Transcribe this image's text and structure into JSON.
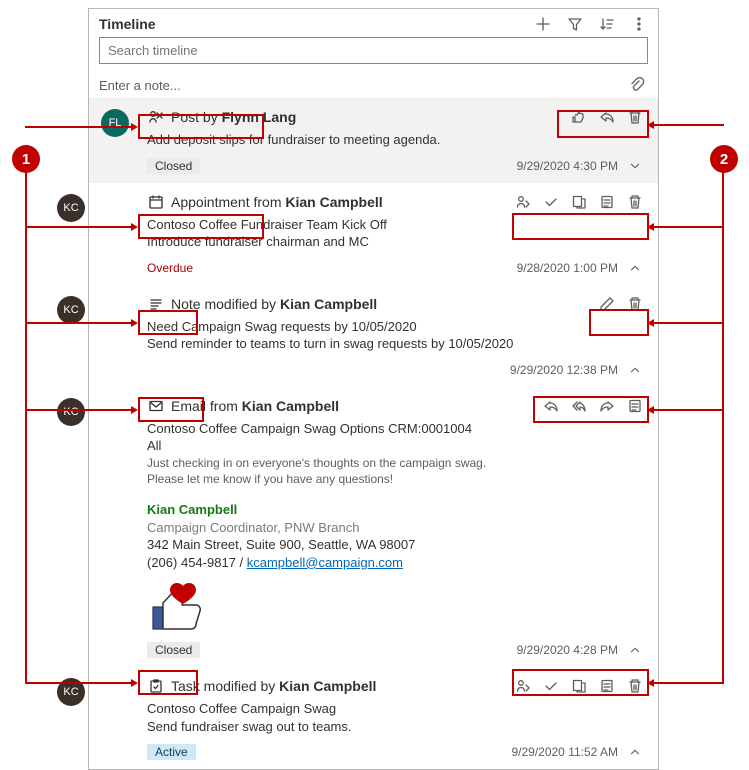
{
  "header": {
    "title": "Timeline",
    "search_placeholder": "Search timeline",
    "note_placeholder": "Enter a note..."
  },
  "callouts": {
    "left": "1",
    "right": "2"
  },
  "items": [
    {
      "avatar": "FL",
      "avatar_class": "av-teal",
      "type": "Post",
      "by_prefix": " by ",
      "author": "Flynn Lang",
      "lines": [
        "Add deposit slips for fundraiser to meeting agenda."
      ],
      "badge": "Closed",
      "badge_class": "",
      "timestamp": "9/29/2020 4:30 PM",
      "chevron": "down",
      "shaded": true,
      "actions": [
        "like",
        "reply",
        "delete"
      ],
      "type_icon": "post"
    },
    {
      "avatar": "KC",
      "avatar_class": "av-brown",
      "type": "Appointment",
      "by_prefix": " from ",
      "author": "Kian Campbell",
      "lines": [
        "Contoso Coffee Fundraiser Team Kick Off",
        "Introduce fundraiser chairman and MC"
      ],
      "badge": "Overdue",
      "badge_class": "overdue",
      "timestamp": "9/28/2020 1:00 PM",
      "chevron": "up",
      "actions": [
        "assign",
        "complete",
        "open",
        "note",
        "delete"
      ],
      "type_icon": "appointment"
    },
    {
      "avatar": "KC",
      "avatar_class": "av-brown",
      "type": "Note",
      "by_prefix": " modified by ",
      "author": "Kian Campbell",
      "lines": [
        "Need Campaign Swag requests by 10/05/2020",
        "Send reminder to teams to turn in swag requests by 10/05/2020"
      ],
      "badge": "",
      "badge_class": "",
      "timestamp": "9/29/2020 12:38 PM",
      "chevron": "up",
      "actions": [
        "edit",
        "delete"
      ],
      "type_icon": "note"
    },
    {
      "avatar": "KC",
      "avatar_class": "av-brown",
      "type": "Email",
      "by_prefix": " from ",
      "author": "Kian Campbell",
      "lines": [
        "Contoso Coffee Campaign Swag Options CRM:0001004"
      ],
      "email_to": "All",
      "email_body1": "Just checking in on everyone's thoughts on the campaign swag.",
      "email_body2": "Please let me know if you have any questions!",
      "sig_name": "Kian Campbell",
      "sig_role": "Campaign Coordinator, PNW Branch",
      "sig_addr": "342 Main Street, Suite 900, Seattle, WA 98007",
      "sig_phone": "(206) 454-9817 / ",
      "sig_email": "kcampbell@campaign.com",
      "badge": "Closed",
      "badge_class": "",
      "timestamp": "9/29/2020 4:28 PM",
      "chevron": "up",
      "actions": [
        "reply",
        "replyall",
        "forward",
        "note"
      ],
      "type_icon": "email"
    },
    {
      "avatar": "KC",
      "avatar_class": "av-brown",
      "type": "Task",
      "by_prefix": " modified by ",
      "author": "Kian Campbell",
      "lines": [
        "Contoso Coffee Campaign Swag",
        "Send fundraiser swag out to teams."
      ],
      "badge": "Active",
      "badge_class": "active",
      "timestamp": "9/29/2020 11:52 AM",
      "chevron": "up",
      "actions": [
        "assign",
        "complete",
        "open",
        "note",
        "delete"
      ],
      "type_icon": "task"
    }
  ]
}
